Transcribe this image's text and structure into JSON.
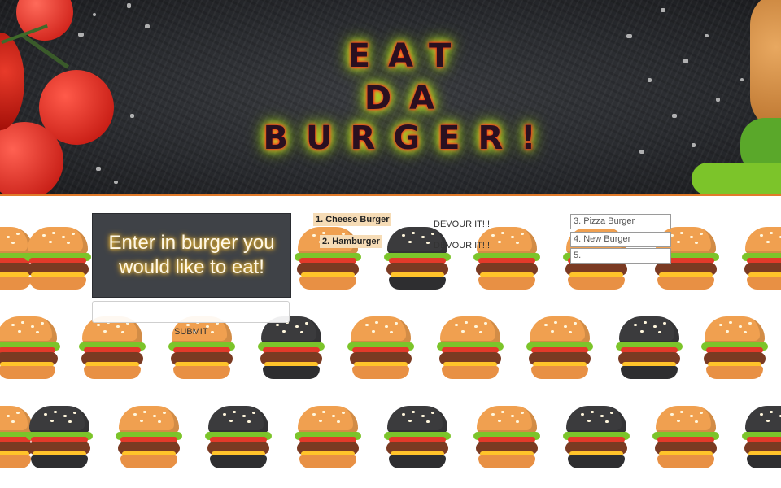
{
  "header": {
    "title_lines": [
      "EAT",
      "DA",
      "BURGER!"
    ]
  },
  "form": {
    "prompt": "Enter in burger you would like to eat!",
    "input_value": "",
    "input_placeholder": "",
    "submit_label": "SUBMIT"
  },
  "uneaten": [
    {
      "label": "1. Cheese Burger",
      "action": "DEVOUR IT!!!"
    },
    {
      "label": "2. Hamburger",
      "action": "DEVOUR IT!!!"
    }
  ],
  "devoured": [
    {
      "label": "3. Pizza Burger"
    },
    {
      "label": "4. New Burger"
    },
    {
      "label": "5."
    }
  ],
  "colors": {
    "header_border": "#e07a2a",
    "title_glow": "#b8ff20",
    "title_text": "#2a1020",
    "card_bg": "#3f4247",
    "pill_bg": "#f6dcb6"
  }
}
